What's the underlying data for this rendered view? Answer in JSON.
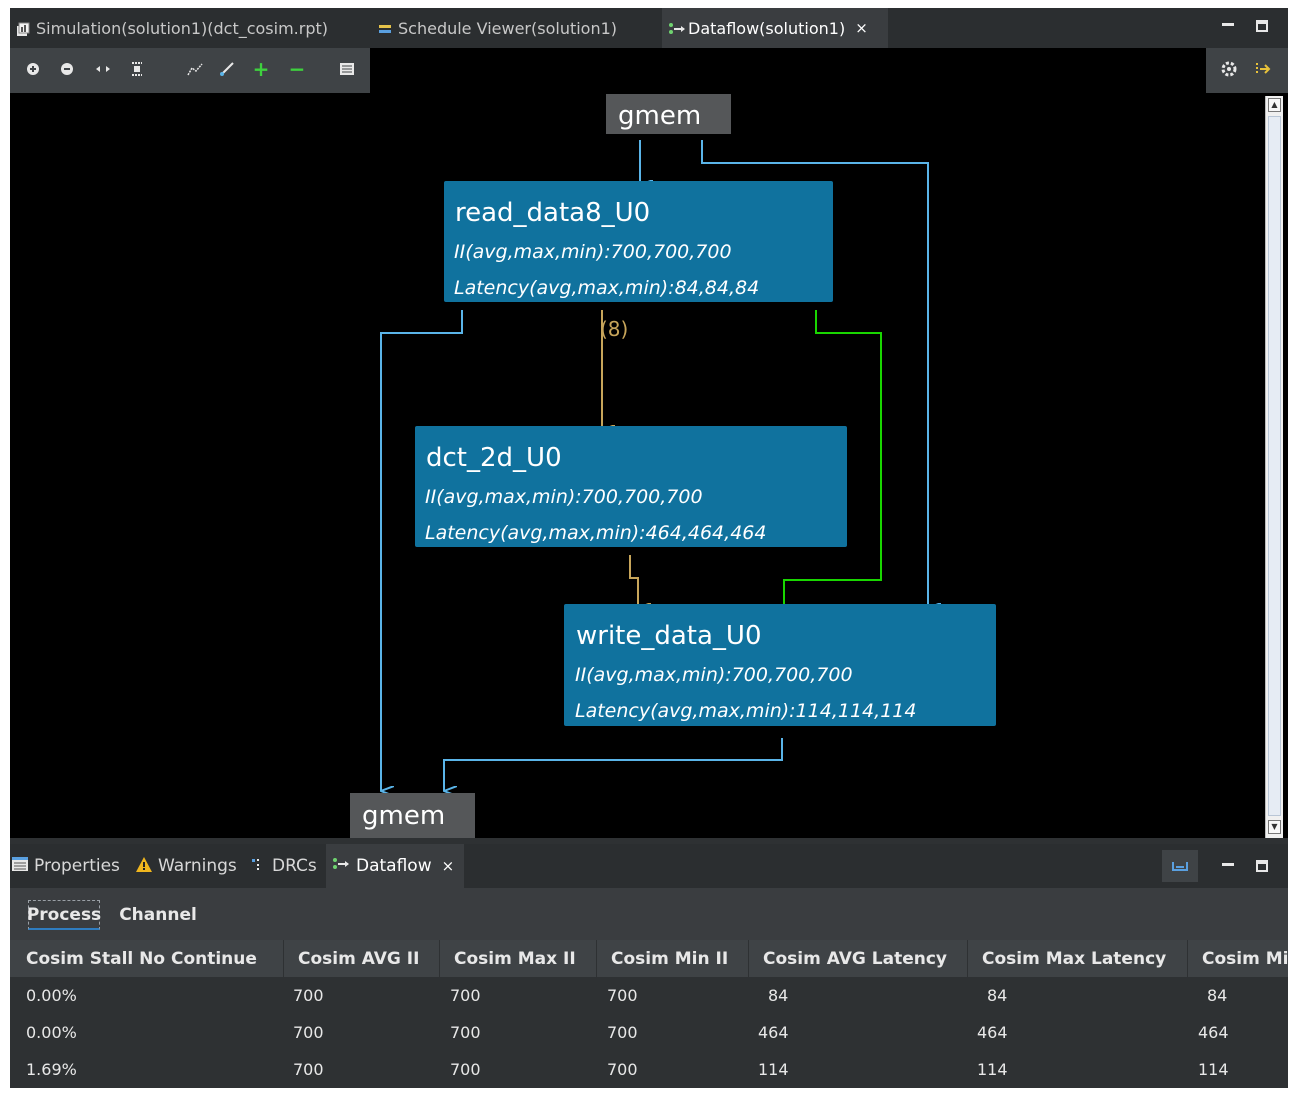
{
  "editor_tabs": [
    {
      "label": "Simulation(solution1)(dct_cosim.rpt)",
      "icon": "report-icon"
    },
    {
      "label": "Schedule Viewer(solution1)",
      "icon": "schedule-icon"
    },
    {
      "label": "Dataflow(solution1)",
      "icon": "dataflow-icon",
      "close": "×"
    }
  ],
  "graph": {
    "gmem_top": "gmem",
    "gmem_bottom": "gmem",
    "nodes": [
      {
        "name": "read_data8_U0",
        "ii": "II(avg,max,min):700,700,700",
        "latency": "Latency(avg,max,min):84,84,84"
      },
      {
        "name": "dct_2d_U0",
        "ii": "II(avg,max,min):700,700,700",
        "latency": "Latency(avg,max,min):464,464,464"
      },
      {
        "name": "write_data_U0",
        "ii": "II(avg,max,min):700,700,700",
        "latency": "Latency(avg,max,min):114,114,114"
      }
    ],
    "channel_label": "(8)"
  },
  "colors": {
    "node_fill": "#10729e",
    "gmem_fill": "#555759",
    "edge_blue": "#5ab4e8",
    "edge_gold": "#c7a55a",
    "edge_green": "#19d600",
    "canvas_bg": "#000000"
  },
  "bottom_tabs": [
    {
      "label": "Properties",
      "icon": "properties-icon"
    },
    {
      "label": "Warnings",
      "icon": "warning-icon"
    },
    {
      "label": "DRCs",
      "icon": "drc-icon"
    },
    {
      "label": "Dataflow",
      "icon": "dataflow-icon",
      "close": "×"
    }
  ],
  "subtabs": [
    "Process",
    "Channel"
  ],
  "table": {
    "headers": [
      "Cosim Stall No Continue",
      "Cosim AVG II",
      "Cosim Max II",
      "Cosim Min II",
      "Cosim AVG Latency",
      "Cosim Max Latency",
      "Cosim Mi"
    ],
    "rows": [
      [
        "0.00%",
        "700",
        "700",
        "700",
        "84",
        "84",
        "84"
      ],
      [
        "0.00%",
        "700",
        "700",
        "700",
        "464",
        "464",
        "464"
      ],
      [
        "1.69%",
        "700",
        "700",
        "700",
        "114",
        "114",
        "114"
      ]
    ]
  }
}
